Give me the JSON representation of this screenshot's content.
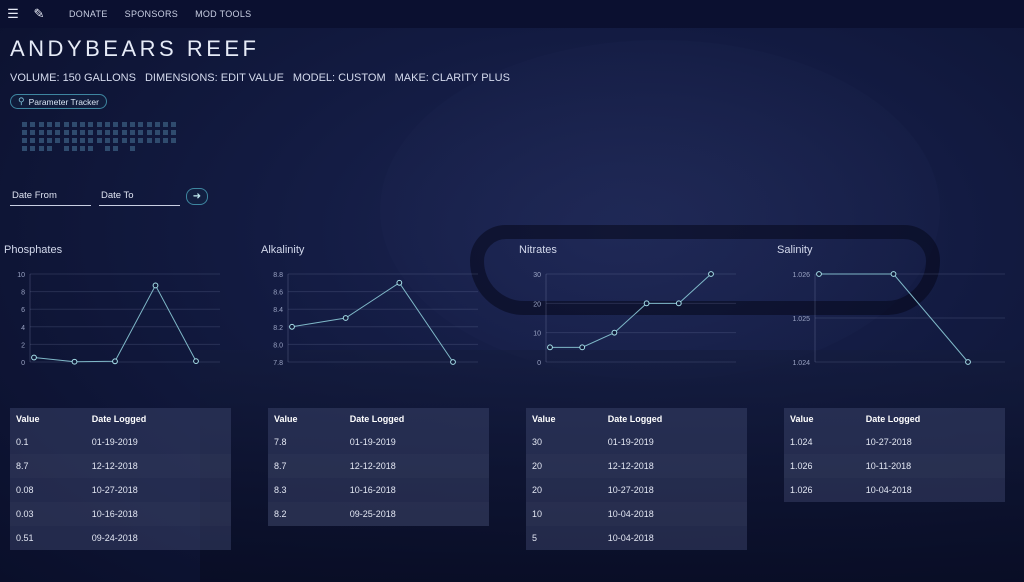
{
  "nav": {
    "menu_icon": "menu-icon",
    "edit_icon": "pencil-icon",
    "links": [
      "DONATE",
      "SPONSORS",
      "MOD TOOLS"
    ]
  },
  "tank": {
    "title": "ANDYBEARS REEF",
    "volume": "VOLUME: 150 GALLONS",
    "dimensions": "DIMENSIONS: EDIT VALUE",
    "model": "MODEL: CUSTOM",
    "make": "MAKE: CLARITY PLUS"
  },
  "param_button": {
    "label": "Parameter Tracker",
    "icon": "search-icon"
  },
  "filters": {
    "date_from": "Date From",
    "date_to": "Date To",
    "go_icon": "arrow-right-icon"
  },
  "colors": {
    "accent": "#3e86a0",
    "line": "#7fb8c8",
    "point_fill": "#0f1838"
  },
  "table_headers": {
    "value": "Value",
    "date": "Date Logged"
  },
  "chart_data": [
    {
      "type": "line",
      "title": "Phosphates",
      "y_ticks": [
        "10",
        "8",
        "6",
        "4",
        "2",
        "0"
      ],
      "ylim": [
        0,
        10
      ],
      "values": [
        0.51,
        0.03,
        0.08,
        8.7,
        0.1
      ],
      "rows": [
        {
          "value": "0.1",
          "date": "01-19-2019"
        },
        {
          "value": "8.7",
          "date": "12-12-2018"
        },
        {
          "value": "0.08",
          "date": "10-27-2018"
        },
        {
          "value": "0.03",
          "date": "10-16-2018"
        },
        {
          "value": "0.51",
          "date": "09-24-2018"
        }
      ]
    },
    {
      "type": "line",
      "title": "Alkalinity",
      "y_ticks": [
        "8.8",
        "8.6",
        "8.4",
        "8.2",
        "8.0",
        "7.8"
      ],
      "ylim": [
        7.8,
        8.8
      ],
      "values": [
        8.2,
        8.3,
        8.7,
        7.8
      ],
      "rows": [
        {
          "value": "7.8",
          "date": "01-19-2019"
        },
        {
          "value": "8.7",
          "date": "12-12-2018"
        },
        {
          "value": "8.3",
          "date": "10-16-2018"
        },
        {
          "value": "8.2",
          "date": "09-25-2018"
        }
      ]
    },
    {
      "type": "line",
      "title": "Nitrates",
      "y_ticks": [
        "30",
        "20",
        "10",
        "0"
      ],
      "ylim": [
        0,
        30
      ],
      "values": [
        5,
        5,
        10,
        20,
        20,
        30
      ],
      "rows": [
        {
          "value": "30",
          "date": "01-19-2019"
        },
        {
          "value": "20",
          "date": "12-12-2018"
        },
        {
          "value": "20",
          "date": "10-27-2018"
        },
        {
          "value": "10",
          "date": "10-04-2018"
        },
        {
          "value": "5",
          "date": "10-04-2018"
        }
      ]
    },
    {
      "type": "line",
      "title": "Salinity",
      "y_ticks": [
        "1.026",
        "1.025",
        "1.024"
      ],
      "ylim": [
        1.024,
        1.026
      ],
      "values": [
        1.026,
        1.026,
        1.024
      ],
      "rows": [
        {
          "value": "1.024",
          "date": "10-27-2018"
        },
        {
          "value": "1.026",
          "date": "10-11-2018"
        },
        {
          "value": "1.026",
          "date": "10-04-2018"
        }
      ]
    }
  ]
}
